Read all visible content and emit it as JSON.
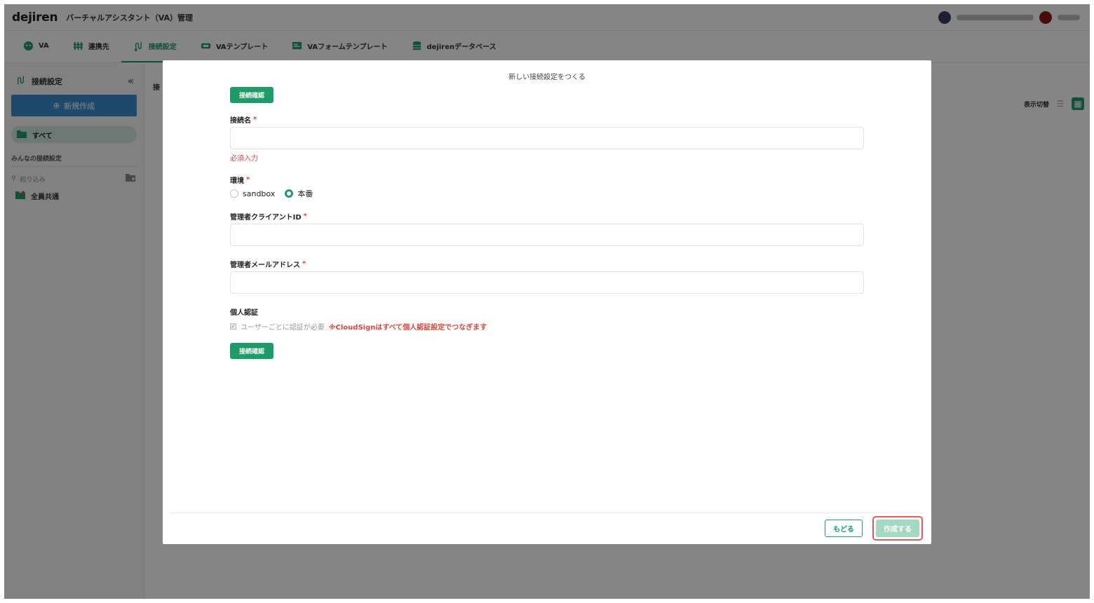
{
  "app": {
    "logo": "dejiren",
    "title": "バーチャルアシスタント（VA）管理"
  },
  "tabs": [
    {
      "label": "VA",
      "icon": "va-icon"
    },
    {
      "label": "連携先",
      "icon": "link-icon"
    },
    {
      "label": "接続設定",
      "icon": "connection-icon",
      "active": true
    },
    {
      "label": "VAテンプレート",
      "icon": "template-icon"
    },
    {
      "label": "VAフォームテンプレート",
      "icon": "form-template-icon"
    },
    {
      "label": "dejirenデータベース",
      "icon": "database-icon"
    }
  ],
  "sidebar": {
    "title": "接続設定",
    "new_button": "新規作成",
    "all_label": "すべて",
    "section_label": "みんなの接続設定",
    "filter_placeholder": "絞り込み",
    "items": [
      {
        "label": "全員共通"
      }
    ]
  },
  "main": {
    "breadcrumb": "接",
    "view_switch_label": "表示切替"
  },
  "modal": {
    "title": "新しい接続設定をつくる",
    "connection_check_label": "接続確認",
    "name": {
      "label": "接続名",
      "required_mark": "*",
      "value": "",
      "error": "必須入力"
    },
    "environment": {
      "label": "環境",
      "required_mark": "*",
      "options": [
        "sandbox",
        "本番"
      ],
      "selected": "本番"
    },
    "client_id": {
      "label": "管理者クライアントID",
      "required_mark": "*",
      "value": ""
    },
    "email": {
      "label": "管理者メールアドレス",
      "required_mark": "*",
      "value": ""
    },
    "personal_auth": {
      "label": "個人認証",
      "checkbox_label": "ユーザーごとに認証が必要",
      "checked": true,
      "note": "※CloudSignはすべて個人認証設定でつなぎます"
    },
    "back_button": "もどる",
    "create_button": "作成する"
  },
  "colors": {
    "accent": "#1f9b6a",
    "error": "#e0453c",
    "new_button": "#3f8fd0",
    "create_disabled": "#a3d9c3",
    "highlight": "#e35d5d"
  }
}
